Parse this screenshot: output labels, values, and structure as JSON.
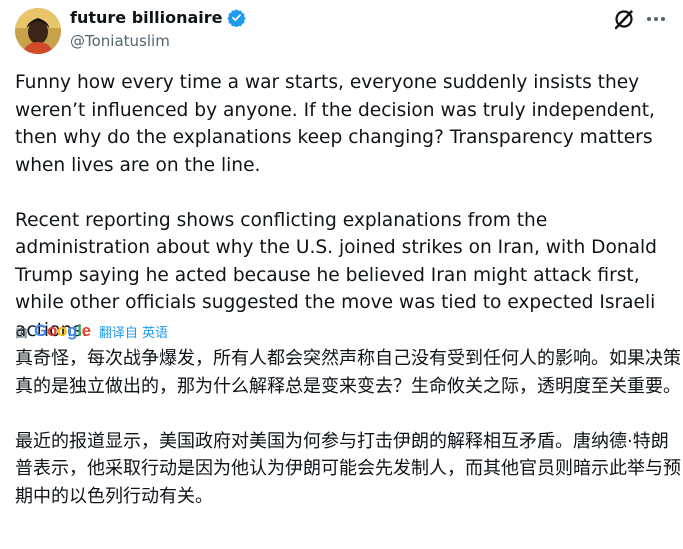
{
  "author": {
    "display_name": "future billionaire",
    "handle": "@Toniatuslim"
  },
  "icons": {
    "verified": "verified-badge-icon",
    "grok": "grok-icon",
    "more": "more-options-icon"
  },
  "colors": {
    "text": "#0f1419",
    "secondary": "#536471",
    "accent": "#1d9bf0"
  },
  "tweet": {
    "paragraph_1": "Funny how every time a war starts, everyone suddenly insists they weren’t influenced by anyone. If the decision was truly independent, then why do the explanations keep changing? Transparency matters when lives are on the line.",
    "paragraph_2": "Recent reporting shows conflicting explanations from the administration about why the U.S. joined strikes on Iran, with Donald Trump saying he acted because he believed Iran might attack first, while other officials suggested the move was tied to expected Israeli actions."
  },
  "translation_bar": {
    "prefix": "由",
    "provider": "Google",
    "link_text": "翻译自 英语"
  },
  "translation": {
    "paragraph_1": "真奇怪，每次战争爆发，所有人都会突然声称自己没有受到任何人的影响。如果决策真的是独立做出的，那为什么解释总是变来变去？生命攸关之际，透明度至关重要。",
    "paragraph_2": "最近的报道显示，美国政府对美国为何参与打击伊朗的解释相互矛盾。唐纳德·特朗普表示，他采取行动是因为他认为伊朗可能会先发制人，而其他官员则暗示此举与预期中的以色列行动有关。"
  }
}
